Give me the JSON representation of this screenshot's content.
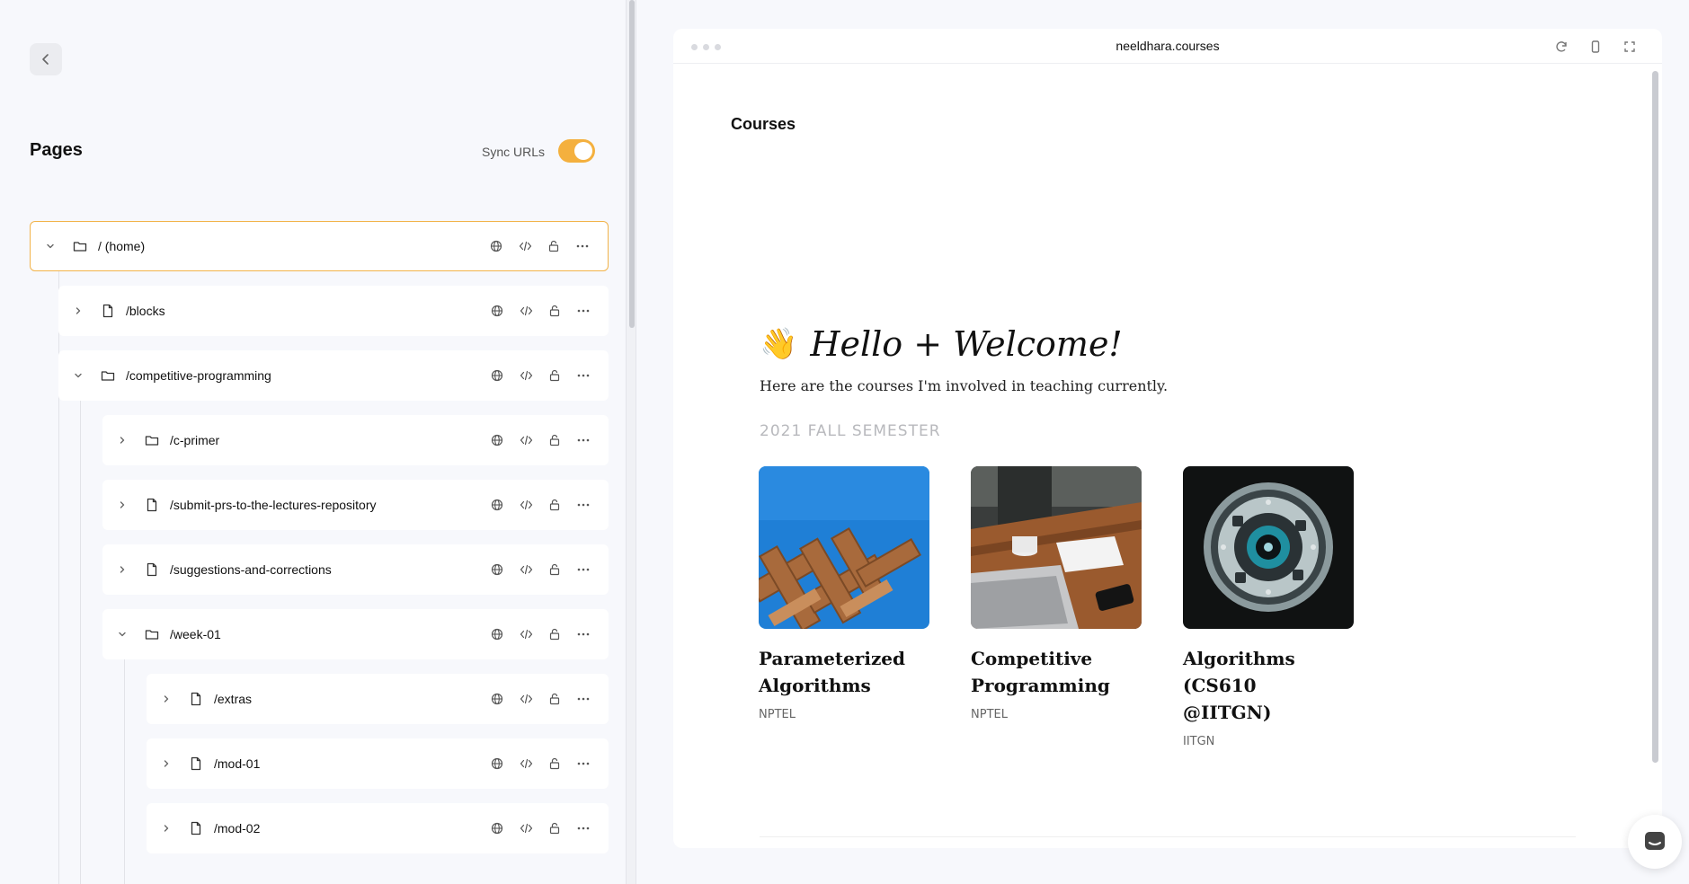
{
  "sidebar": {
    "title": "Pages",
    "sync_label": "Sync URLs",
    "sync_enabled": true,
    "rows": [
      {
        "label": "/ (home)",
        "type": "folder",
        "expanded": true,
        "selected": true
      },
      {
        "label": "/blocks",
        "type": "page",
        "expanded": false
      },
      {
        "label": "/competitive-programming",
        "type": "folder",
        "expanded": true
      },
      {
        "label": "/c-primer",
        "type": "folder",
        "expanded": false
      },
      {
        "label": "/submit-prs-to-the-lectures-repository",
        "type": "page",
        "expanded": false
      },
      {
        "label": "/suggestions-and-corrections",
        "type": "page",
        "expanded": false
      },
      {
        "label": "/week-01",
        "type": "folder",
        "expanded": true
      },
      {
        "label": "/extras",
        "type": "page",
        "expanded": false
      },
      {
        "label": "/mod-01",
        "type": "page",
        "expanded": false
      },
      {
        "label": "/mod-02",
        "type": "page",
        "expanded": false
      }
    ]
  },
  "preview": {
    "url": "neeldhara.courses",
    "site_title": "Courses",
    "hello_heading": "Hello + Welcome!",
    "wave_emoji": "👋",
    "subtitle": "Here are the courses I'm involved in teaching currently.",
    "semester": "2021 FALL SEMESTER",
    "courses": [
      {
        "title_line1": "Parameterized",
        "title_line2": "Algorithms",
        "sub": "NPTEL"
      },
      {
        "title_line1": "Competitive",
        "title_line2": "Programming",
        "sub": "NPTEL"
      },
      {
        "title_line1": "Algorithms (CS610",
        "title_line2": "@IITGN)",
        "sub": "IITGN"
      }
    ]
  },
  "colors": {
    "accent": "#f4b03e",
    "selected_border": "#f2b34a"
  }
}
